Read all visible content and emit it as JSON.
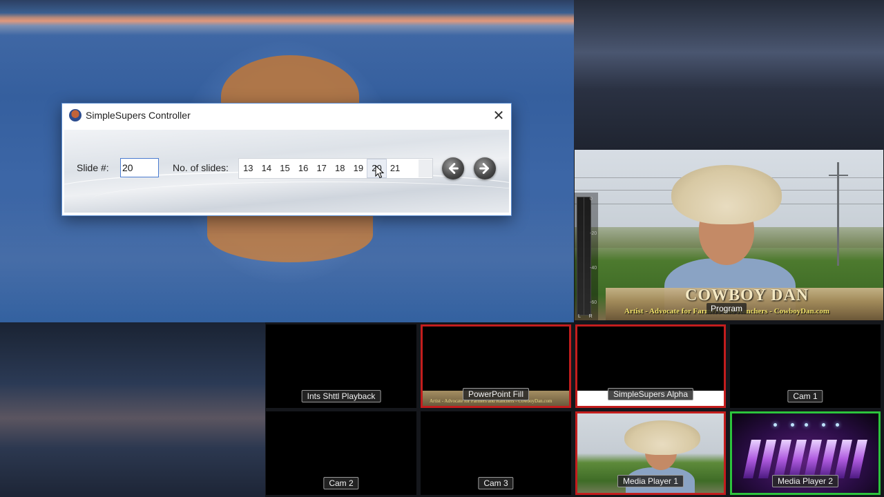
{
  "dialog": {
    "title": "SimpleSupers Controller",
    "close_glyph": "✕",
    "slide_label": "Slide #:",
    "slide_value": "20",
    "num_slides_label": "No. of slides:",
    "slide_numbers": [
      "13",
      "14",
      "15",
      "16",
      "17",
      "18",
      "19",
      "20",
      "21"
    ],
    "selected_slide": "20",
    "prev_icon": "arrow-left-icon",
    "next_icon": "arrow-right-icon"
  },
  "program": {
    "label": "Program",
    "lower_third_name": "COWBOY DAN",
    "lower_third_tagline": "Artist - Advocate for Farmers and Ranchers - CowboyDan.com",
    "vu_ticks": [
      "0",
      "-20",
      "-40",
      "-60"
    ],
    "vu_channels": "L R"
  },
  "multiview": {
    "tiles": [
      {
        "label": "Ints Shttl Playback",
        "tally": "none"
      },
      {
        "label": "PowerPoint Fill",
        "tally": "red",
        "strip_text": "Artist - Advocate for Farmers and Ranchers - CowboyDan.com"
      },
      {
        "label": "SimpleSupers Alpha",
        "tally": "red"
      },
      {
        "label": "Cam 1",
        "tally": "none"
      },
      {
        "label": "Cam 2",
        "tally": "none"
      },
      {
        "label": "Cam 3",
        "tally": "none"
      },
      {
        "label": "Media Player 1",
        "tally": "red"
      },
      {
        "label": "Media Player 2",
        "tally": "green"
      }
    ]
  },
  "colors": {
    "tally_red": "#c31d1d",
    "tally_green": "#2cc43c",
    "dialog_border": "#5a8cd0"
  }
}
